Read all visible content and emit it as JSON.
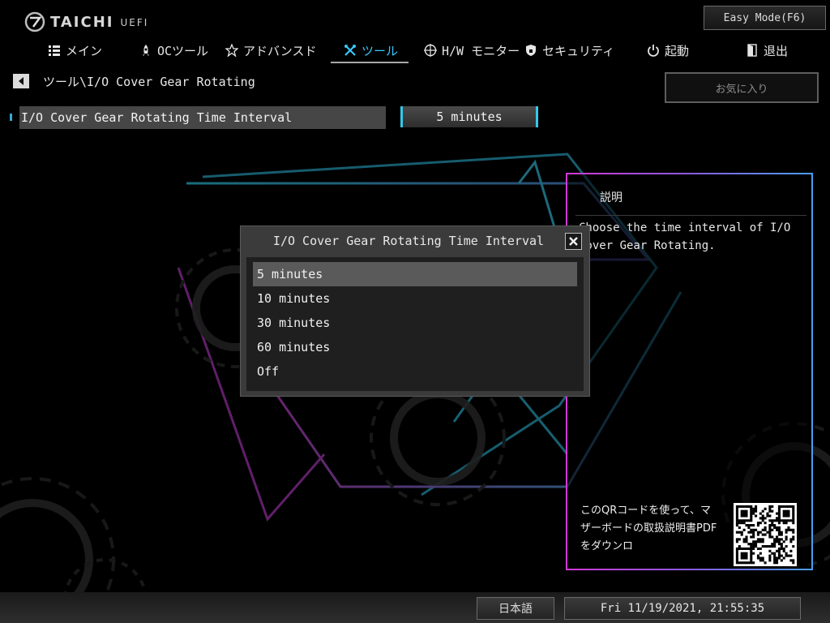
{
  "brand": {
    "name": "TAICHI",
    "sub": "UEFI"
  },
  "easy_mode_label": "Easy Mode(F6)",
  "nav": {
    "items": [
      {
        "label": "メイン",
        "icon": "list-icon"
      },
      {
        "label": "OCツール",
        "icon": "rocket-icon"
      },
      {
        "label": "アドバンスド",
        "icon": "star-icon"
      },
      {
        "label": "ツール",
        "icon": "tools-icon",
        "active": true
      },
      {
        "label": "H/W モニター",
        "icon": "crosshair-icon"
      },
      {
        "label": "セキュリティ",
        "icon": "shield-icon"
      },
      {
        "label": "起動",
        "icon": "power-icon"
      },
      {
        "label": "退出",
        "icon": "exit-door-icon"
      }
    ]
  },
  "breadcrumb": "ツール\\I/O Cover Gear Rotating",
  "favorite_label": "お気に入り",
  "setting": {
    "label": "I/O Cover Gear Rotating Time Interval",
    "value": "5 minutes"
  },
  "description": {
    "title": "説明",
    "text": "Choose the time interval of I/O Cover Gear Rotating.",
    "qr_text": "このQRコードを使って、マザーボードの取扱説明書PDFをダウンロ"
  },
  "popup": {
    "title": "I/O Cover Gear Rotating Time Interval",
    "options": [
      "5 minutes",
      "10 minutes",
      "30 minutes",
      "60 minutes",
      "Off"
    ],
    "selected_index": 0
  },
  "footer": {
    "language": "日本語",
    "datetime": "Fri 11/19/2021, 21:55:35"
  },
  "colors": {
    "accent_cyan": "#35c8ea",
    "active_nav": "#38c8ff",
    "panel_magenta": "#d23ad6",
    "panel_blue": "#4a9ef0"
  }
}
